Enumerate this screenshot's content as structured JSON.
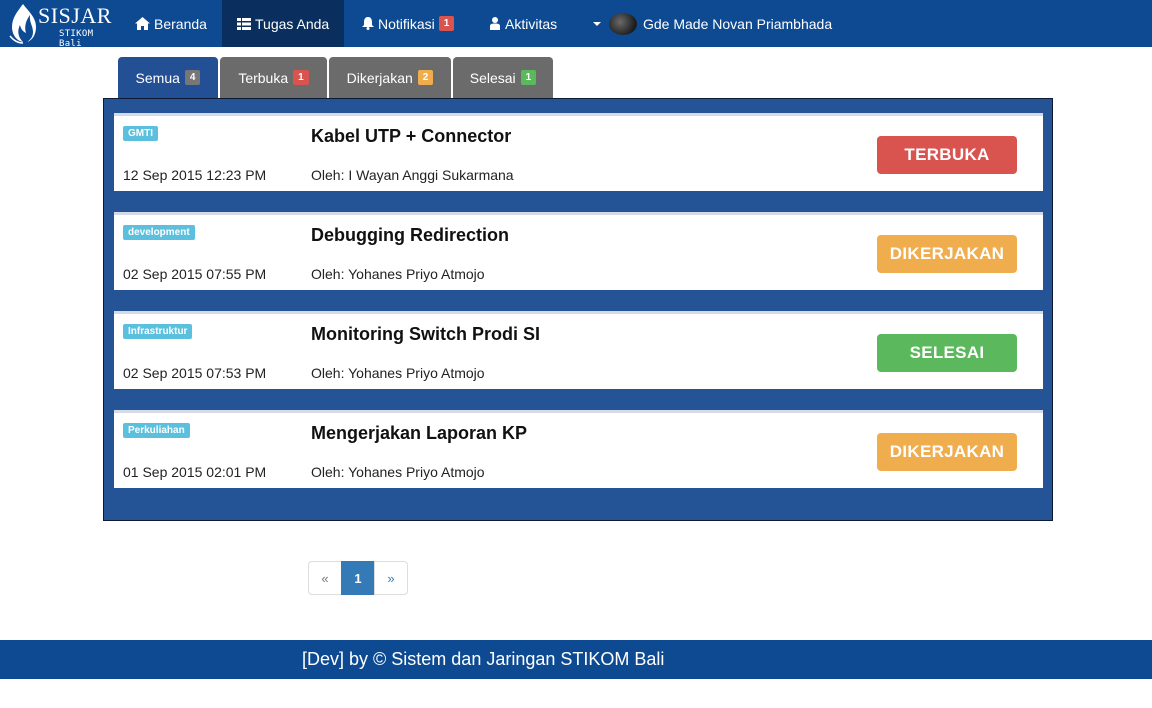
{
  "brand": {
    "title": "SISJAR",
    "subtitle": "STIKOM Bali",
    "logo_icon": "flame-logo-icon"
  },
  "nav": {
    "items": [
      {
        "label": "Beranda",
        "icon": "home-icon"
      },
      {
        "label": "Tugas Anda",
        "icon": "table-icon",
        "active": true
      },
      {
        "label": "Notifikasi",
        "icon": "bell-icon",
        "badge": "1"
      },
      {
        "label": "Aktivitas",
        "icon": "user-icon"
      }
    ],
    "user": {
      "name": "Gde Made Novan Priambhada",
      "avatar": "user-avatar"
    }
  },
  "tabs": [
    {
      "label": "Semua",
      "count": "4",
      "badge_color": "#777777",
      "active": true
    },
    {
      "label": "Terbuka",
      "count": "1",
      "badge_color": "#d9534f"
    },
    {
      "label": "Dikerjakan",
      "count": "2",
      "badge_color": "#f0ad4e"
    },
    {
      "label": "Selesai",
      "count": "1",
      "badge_color": "#5cb85c"
    }
  ],
  "tasks": [
    {
      "category": "GMTI",
      "title": "Kabel UTP + Connector",
      "date": "12 Sep 2015 12:23 PM",
      "author": "Oleh: I Wayan Anggi Sukarmana",
      "status": "TERBUKA",
      "status_color": "#d9534f"
    },
    {
      "category": "development",
      "title": "Debugging Redirection",
      "date": "02 Sep 2015 07:55 PM",
      "author": "Oleh: Yohanes Priyo Atmojo",
      "status": "DIKERJAKAN",
      "status_color": "#f0ad4e"
    },
    {
      "category": "Infrastruktur",
      "title": "Monitoring Switch Prodi SI",
      "date": "02 Sep 2015 07:53 PM",
      "author": "Oleh: Yohanes Priyo Atmojo",
      "status": "SELESAI",
      "status_color": "#5cb85c"
    },
    {
      "category": "Perkuliahan",
      "title": "Mengerjakan Laporan KP",
      "date": "01 Sep 2015 02:01 PM",
      "author": "Oleh: Yohanes Priyo Atmojo",
      "status": "DIKERJAKAN",
      "status_color": "#f0ad4e"
    }
  ],
  "pagination": {
    "prev": "«",
    "current": "1",
    "next": "»"
  },
  "footer": {
    "text": "[Dev] by © Sistem dan Jaringan STIKOM Bali"
  },
  "colors": {
    "navbar": "#0d4a92",
    "panel": "#245396",
    "active_nav": "#0a2f5e",
    "category_badge": "#5bc0de"
  }
}
